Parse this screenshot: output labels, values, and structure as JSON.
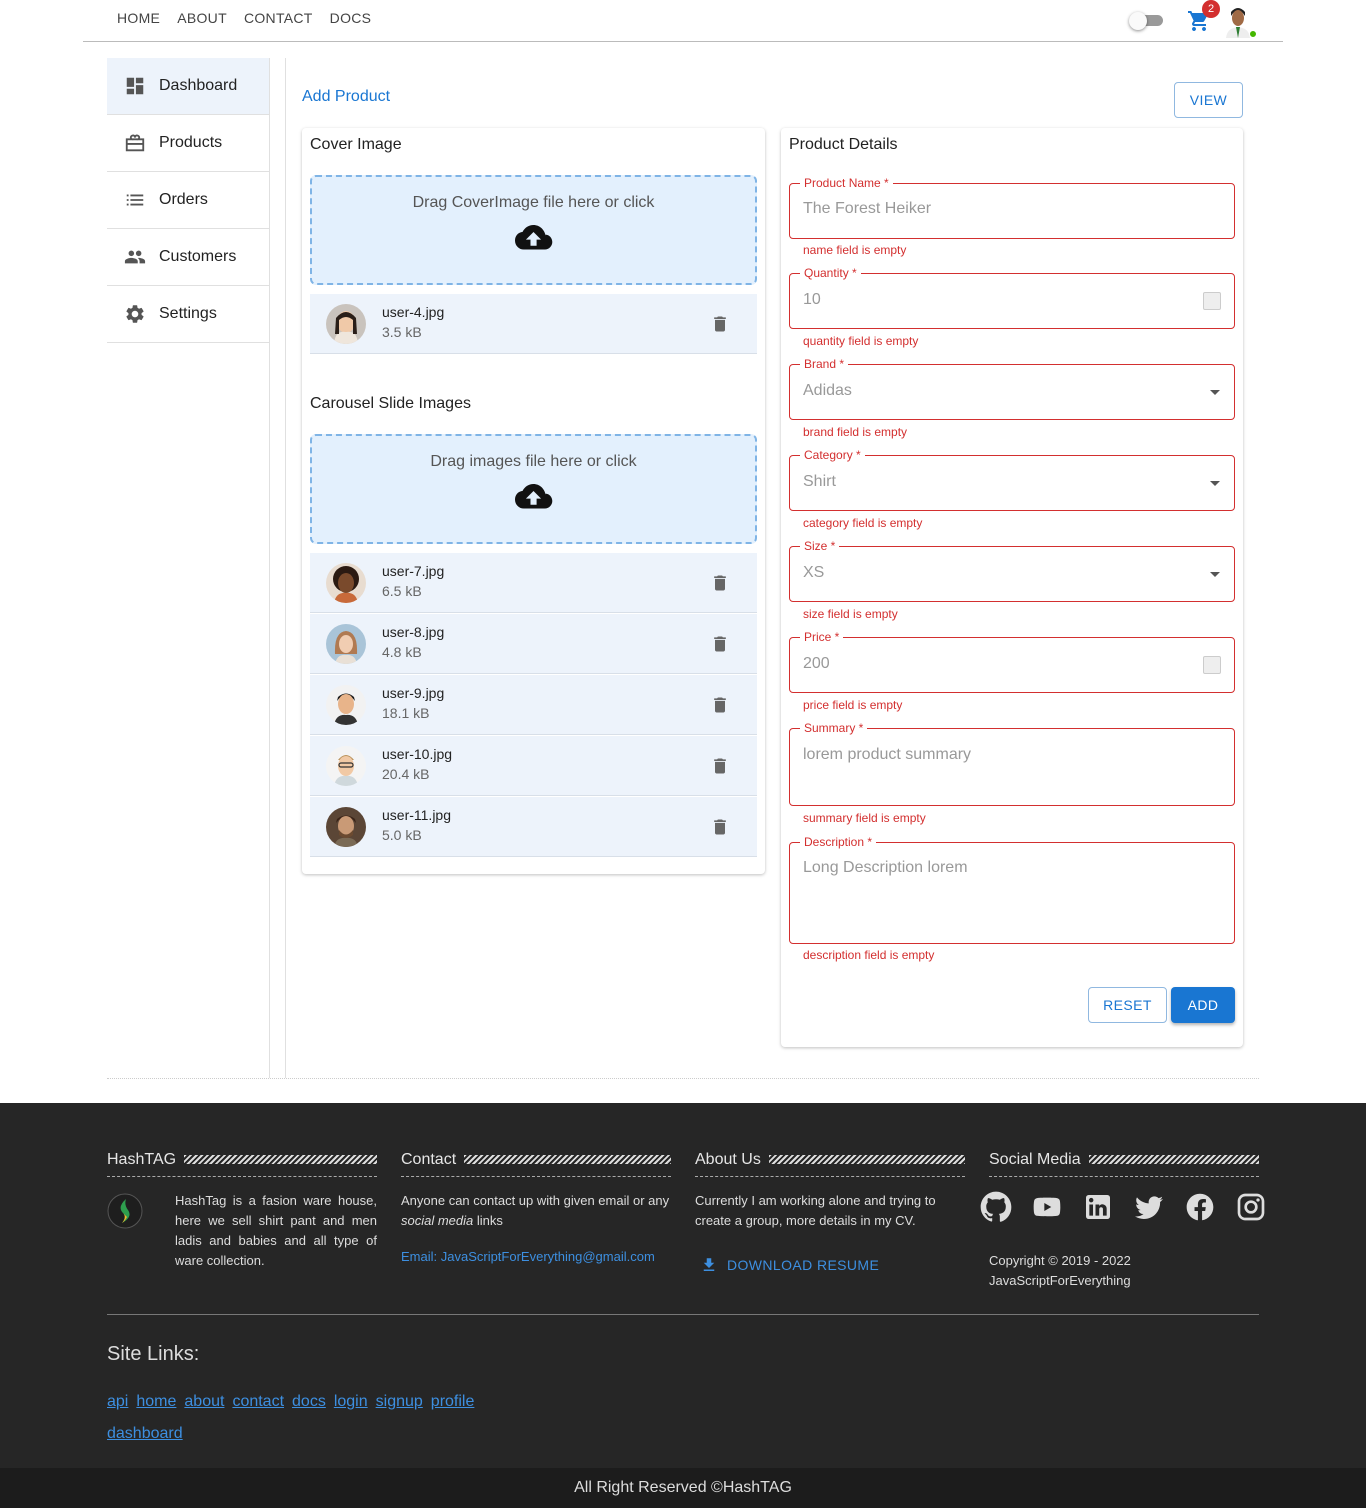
{
  "nav": {
    "items": [
      "HOME",
      "ABOUT",
      "CONTACT",
      "DOCS"
    ],
    "cart_count": "2"
  },
  "sidebar": {
    "items": [
      "Dashboard",
      "Products",
      "Orders",
      "Customers",
      "Settings"
    ]
  },
  "page": {
    "title": "Add Product",
    "view_label": "VIEW"
  },
  "cover": {
    "title": "Cover Image",
    "drop_text": "Drag CoverImage file here or click",
    "file": {
      "name": "user-4.jpg",
      "size": "3.5 kB"
    }
  },
  "carousel": {
    "title": "Carousel Slide Images",
    "drop_text": "Drag images file here or click",
    "files": [
      {
        "name": "user-7.jpg",
        "size": "6.5 kB"
      },
      {
        "name": "user-8.jpg",
        "size": "4.8 kB"
      },
      {
        "name": "user-9.jpg",
        "size": "18.1 kB"
      },
      {
        "name": "user-10.jpg",
        "size": "20.4 kB"
      },
      {
        "name": "user-11.jpg",
        "size": "5.0 kB"
      }
    ]
  },
  "details": {
    "title": "Product Details",
    "fields": [
      {
        "label": "Product Name *",
        "value": "The Forest Heiker",
        "error": "name field is empty"
      },
      {
        "label": "Quantity *",
        "value": "10",
        "error": "quantity field is empty"
      },
      {
        "label": "Brand *",
        "value": "Adidas",
        "error": "brand field is empty"
      },
      {
        "label": "Category *",
        "value": "Shirt",
        "error": "category field is empty"
      },
      {
        "label": "Size *",
        "value": "XS",
        "error": "size field is empty"
      },
      {
        "label": "Price *",
        "value": "200",
        "error": "price field is empty"
      },
      {
        "label": "Summary *",
        "value": "lorem product summary",
        "error": "summary field is empty"
      },
      {
        "label": "Description *",
        "value": "Long Description lorem",
        "error": "description field is empty"
      }
    ],
    "reset_label": "RESET",
    "add_label": "ADD"
  },
  "footer": {
    "hashtag": {
      "title": "HashTAG",
      "text": "HashTag is a fasion ware house, here we sell shirt pant and men ladis and babies and all type of ware collection."
    },
    "contact": {
      "title": "Contact",
      "text_a": "Anyone can contact up with given email or any ",
      "text_em": "social media",
      "text_b": " links",
      "email": "Email: JavaScriptForEverything@gmail.com"
    },
    "about": {
      "title": "About Us",
      "text": "Currently I am working alone and trying to create a group, more details in my CV.",
      "resume": "DOWNLOAD RESUME"
    },
    "social": {
      "title": "Social Media",
      "icons": [
        "github-icon",
        "youtube-icon",
        "linkedin-icon",
        "twitter-icon",
        "facebook-icon",
        "instagram-icon"
      ],
      "copyright": "Copyright © 2019 - 2022",
      "owner": "JavaScriptForEverything"
    },
    "sitelinks_title": "Site Links:",
    "sitelinks": [
      "api",
      "home",
      "about",
      "contact",
      "docs",
      "login",
      "signup",
      "profile",
      "dashboard"
    ],
    "rights": "All Right Reserved ©HashTAG"
  },
  "colors": {
    "accent": "#1976d2",
    "error": "#d32f2f",
    "footer_bg": "#262626"
  }
}
